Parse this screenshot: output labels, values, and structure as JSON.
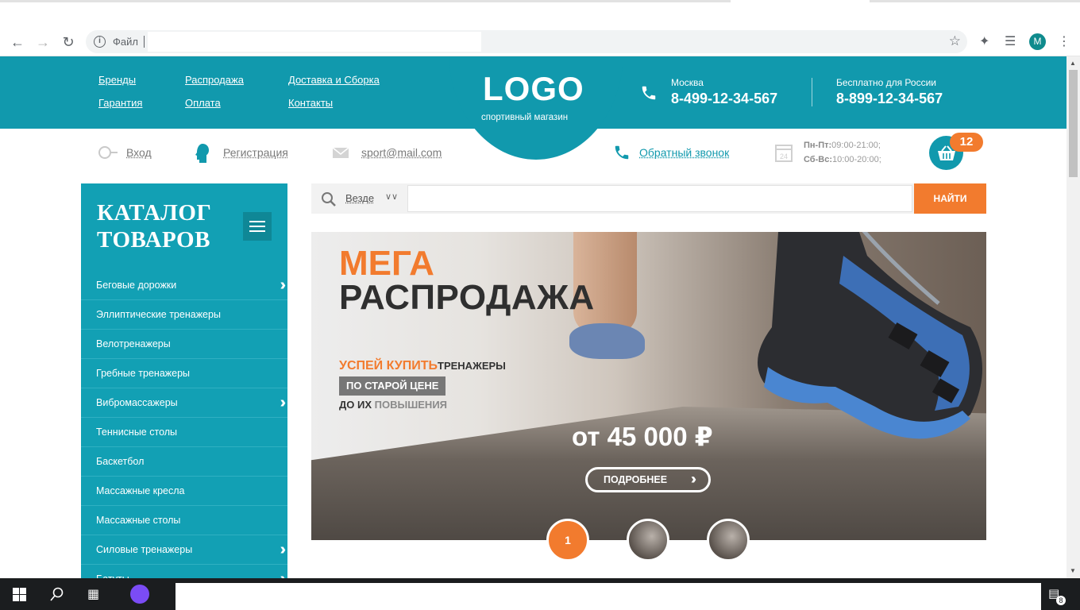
{
  "browser": {
    "address_label": "Файл",
    "avatar_letter": "M"
  },
  "header": {
    "nav": [
      "Бренды",
      "Распродажа",
      "Доставка и Сборка",
      "Гарантия",
      "Оплата",
      "Контакты"
    ],
    "logo": "LOGO",
    "logo_sub": "спортивный магазин",
    "contacts": [
      {
        "city": "Москва",
        "phone": "8-499-12-34-567"
      },
      {
        "city": "Бесплатно для России",
        "phone": "8-899-12-34-567"
      }
    ]
  },
  "subbar": {
    "login": "Вход",
    "register": "Регистрация",
    "email": "sport@mail.com",
    "callback": "Обратный звонок",
    "hours": [
      {
        "days": "Пн-Пт:",
        "time": "09:00-21:00;"
      },
      {
        "days": "Сб-Вс:",
        "time": "10:00-20:00;"
      }
    ],
    "cart_count": "12"
  },
  "catalog": {
    "title_line1": "КАТАЛОГ",
    "title_line2": "ТОВАРОВ",
    "items": [
      {
        "label": "Беговые дорожки",
        "arrow": true
      },
      {
        "label": "Эллиптические тренажеры",
        "arrow": false
      },
      {
        "label": "Велотренажеры",
        "arrow": false
      },
      {
        "label": "Гребные тренажеры",
        "arrow": false
      },
      {
        "label": "Вибромассажеры",
        "arrow": true
      },
      {
        "label": "Теннисные столы",
        "arrow": false
      },
      {
        "label": "Баскетбол",
        "arrow": false
      },
      {
        "label": "Массажные кресла",
        "arrow": false
      },
      {
        "label": "Массажные столы",
        "arrow": false
      },
      {
        "label": "Силовые тренажеры",
        "arrow": true
      },
      {
        "label": "Батуты",
        "arrow": true
      }
    ]
  },
  "search": {
    "scope": "Везде",
    "placeholder": "",
    "button": "НАЙТИ"
  },
  "banner": {
    "mega": "МЕГА",
    "title": "РАСПРОДАЖА",
    "line1_accent": "УСПЕЙ КУПИТЬ",
    "line1_rest": "ТРЕНАЖЕРЫ",
    "line2": "ПО СТАРОЙ ЦЕНЕ",
    "line3_a": "ДО ИХ ",
    "line3_b": "ПОВЫШЕНИЯ",
    "price": "от 45 000 ₽",
    "more": "ПОДРОБНЕЕ",
    "slide_active": "1"
  },
  "taskbar": {
    "notifications": "8"
  },
  "colors": {
    "brand": "#1199ad",
    "accent": "#f27b2e"
  }
}
